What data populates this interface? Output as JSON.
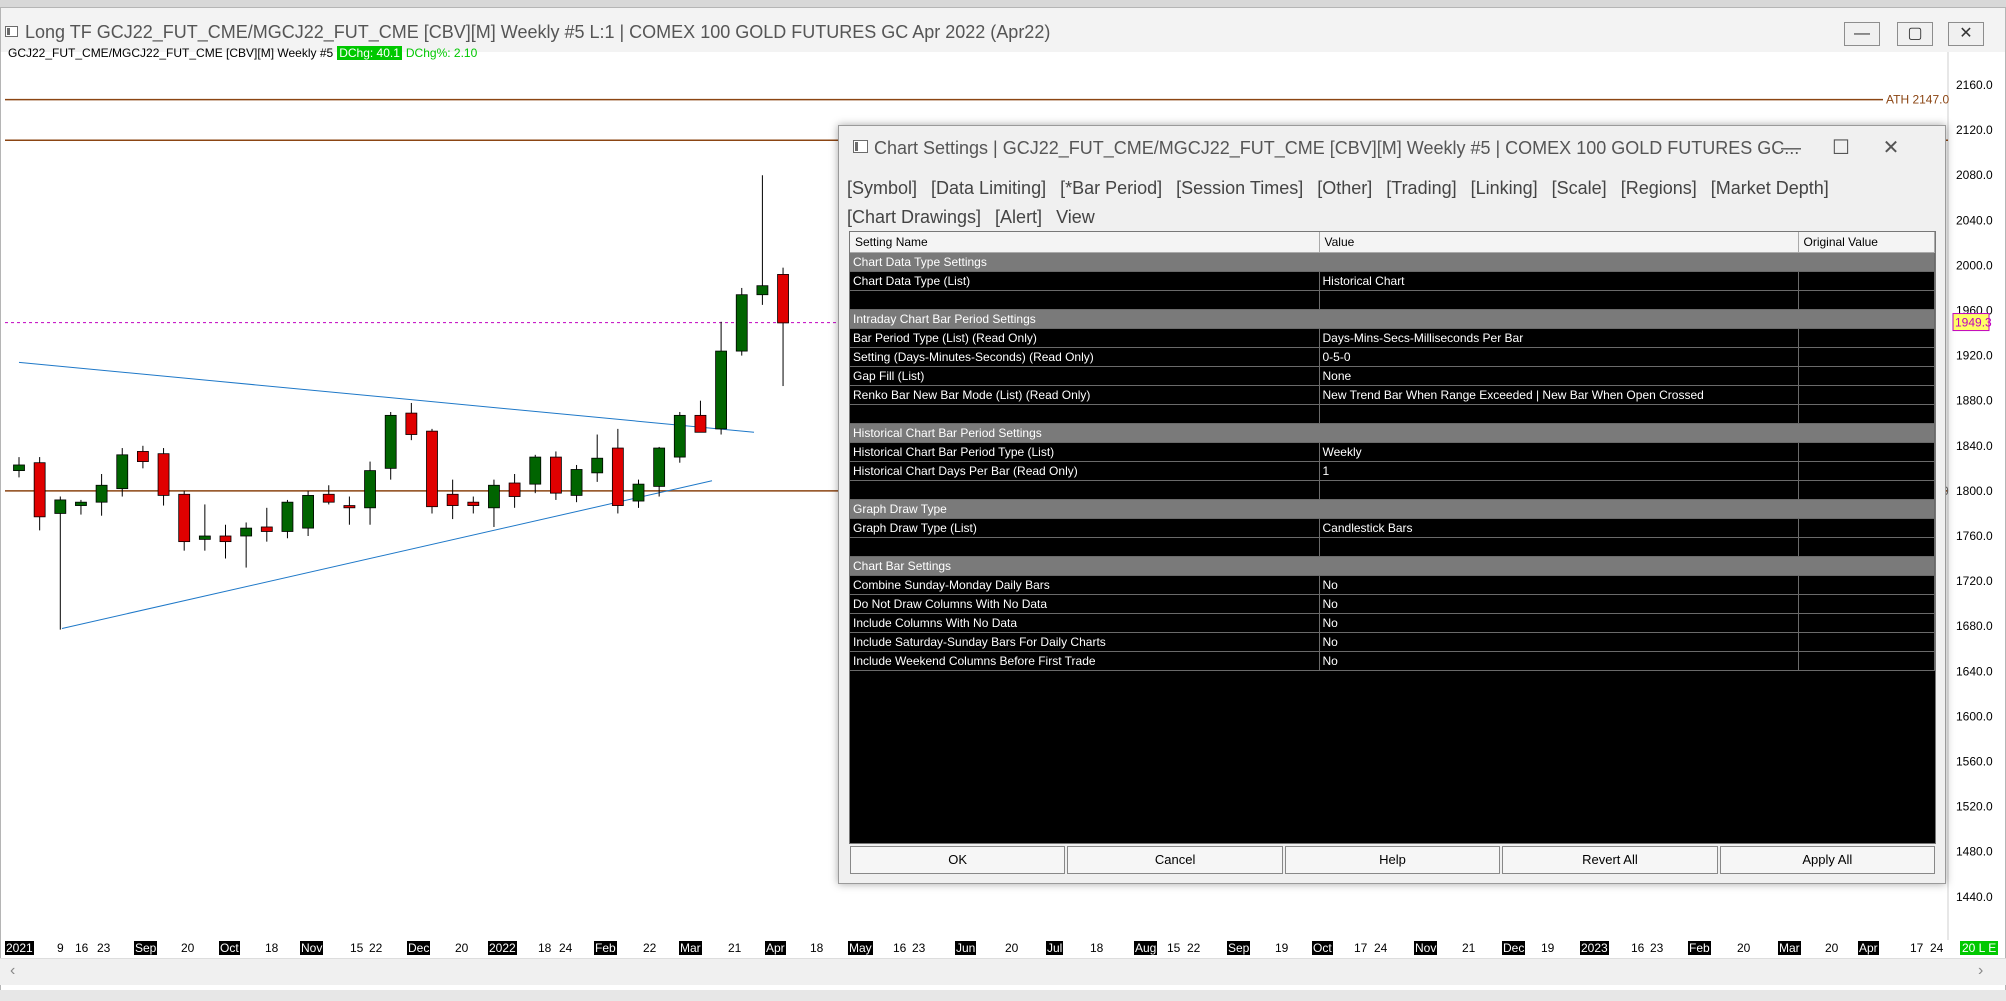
{
  "main_window": {
    "title": "Long TF GCJ22_FUT_CME/MGCJ22_FUT_CME [CBV][M]  Weekly  #5 L:1 | COMEX 100 GOLD FUTURES GC Apr 2022 (Apr22)",
    "minimize": "—",
    "maximize": "▢",
    "close": "✕"
  },
  "chart_info": {
    "symbol_text": "GCJ22_FUT_CME/MGCJ22_FUT_CME [CBV][M]  Weekly  #5",
    "dchg": "DChg: 40.1",
    "dchg_pct": "DChg%: 2.10"
  },
  "price_markers": {
    "ath_label": "ATH  2147.0",
    "last_price": "1949.3",
    "partial_label": "0"
  },
  "colors": {
    "up": "#006400",
    "down": "#e00000",
    "ath_line": "#8b4513",
    "trendline": "#1e78c8",
    "last_price_line": "#c000c0",
    "accent_green": "#00c800"
  },
  "chart_data": {
    "type": "candlestick",
    "yticks": [
      "2160.0",
      "2120.0",
      "2080.0",
      "2040.0",
      "2000.0",
      "1960.0",
      "1920.0",
      "1880.0",
      "1840.0",
      "1800.0",
      "1760.0",
      "1720.0",
      "1680.0",
      "1640.0",
      "1600.0",
      "1560.0",
      "1520.0",
      "1480.0",
      "1440.0"
    ],
    "ylim": [
      1440,
      2160
    ],
    "horizontal_lines": [
      2147.0,
      2111.0,
      1800.0
    ],
    "last_price": 1949.3,
    "candles": [
      {
        "o": 1818,
        "h": 1830,
        "l": 1812,
        "c": 1823
      },
      {
        "o": 1825,
        "h": 1830,
        "l": 1765,
        "c": 1777
      },
      {
        "o": 1780,
        "h": 1795,
        "l": 1677,
        "c": 1792
      },
      {
        "o": 1787,
        "h": 1792,
        "l": 1779,
        "c": 1790
      },
      {
        "o": 1790,
        "h": 1815,
        "l": 1778,
        "c": 1805
      },
      {
        "o": 1802,
        "h": 1838,
        "l": 1795,
        "c": 1832
      },
      {
        "o": 1835,
        "h": 1840,
        "l": 1820,
        "c": 1826
      },
      {
        "o": 1833,
        "h": 1838,
        "l": 1787,
        "c": 1796
      },
      {
        "o": 1797,
        "h": 1800,
        "l": 1747,
        "c": 1755
      },
      {
        "o": 1757,
        "h": 1788,
        "l": 1747,
        "c": 1760
      },
      {
        "o": 1760,
        "h": 1770,
        "l": 1740,
        "c": 1755
      },
      {
        "o": 1760,
        "h": 1772,
        "l": 1732,
        "c": 1767
      },
      {
        "o": 1768,
        "h": 1785,
        "l": 1755,
        "c": 1764
      },
      {
        "o": 1764,
        "h": 1792,
        "l": 1758,
        "c": 1790
      },
      {
        "o": 1767,
        "h": 1800,
        "l": 1760,
        "c": 1796
      },
      {
        "o": 1797,
        "h": 1805,
        "l": 1788,
        "c": 1790
      },
      {
        "o": 1787,
        "h": 1795,
        "l": 1770,
        "c": 1785
      },
      {
        "o": 1785,
        "h": 1826,
        "l": 1770,
        "c": 1818
      },
      {
        "o": 1820,
        "h": 1870,
        "l": 1810,
        "c": 1867
      },
      {
        "o": 1869,
        "h": 1878,
        "l": 1845,
        "c": 1850
      },
      {
        "o": 1853,
        "h": 1855,
        "l": 1780,
        "c": 1786
      },
      {
        "o": 1797,
        "h": 1810,
        "l": 1775,
        "c": 1787
      },
      {
        "o": 1790,
        "h": 1795,
        "l": 1780,
        "c": 1787
      },
      {
        "o": 1785,
        "h": 1810,
        "l": 1768,
        "c": 1805
      },
      {
        "o": 1807,
        "h": 1815,
        "l": 1785,
        "c": 1795
      },
      {
        "o": 1806,
        "h": 1832,
        "l": 1798,
        "c": 1830
      },
      {
        "o": 1830,
        "h": 1835,
        "l": 1792,
        "c": 1798
      },
      {
        "o": 1796,
        "h": 1823,
        "l": 1790,
        "c": 1819
      },
      {
        "o": 1816,
        "h": 1850,
        "l": 1808,
        "c": 1829
      },
      {
        "o": 1838,
        "h": 1855,
        "l": 1780,
        "c": 1787
      },
      {
        "o": 1791,
        "h": 1810,
        "l": 1785,
        "c": 1806
      },
      {
        "o": 1804,
        "h": 1839,
        "l": 1795,
        "c": 1838
      },
      {
        "o": 1830,
        "h": 1870,
        "l": 1825,
        "c": 1867
      },
      {
        "o": 1867,
        "h": 1880,
        "l": 1853,
        "c": 1852
      },
      {
        "o": 1855,
        "h": 1950,
        "l": 1850,
        "c": 1924
      },
      {
        "o": 1924,
        "h": 1980,
        "l": 1920,
        "c": 1974
      },
      {
        "o": 1974,
        "h": 2080,
        "l": 1965,
        "c": 1982
      },
      {
        "o": 1992,
        "h": 1998,
        "l": 1893,
        "c": 1949
      }
    ],
    "xticks": [
      {
        "t": "2021",
        "dark": true
      },
      {
        "t": "9",
        "dark": false
      },
      {
        "t": "16",
        "dark": false
      },
      {
        "t": "23",
        "dark": false
      },
      {
        "t": "Sep",
        "dark": true
      },
      {
        "t": "20",
        "dark": false
      },
      {
        "t": "Oct",
        "dark": true
      },
      {
        "t": "18",
        "dark": false
      },
      {
        "t": "Nov",
        "dark": true
      },
      {
        "t": "15",
        "dark": false
      },
      {
        "t": "22",
        "dark": false
      },
      {
        "t": "Dec",
        "dark": true
      },
      {
        "t": "20",
        "dark": false
      },
      {
        "t": "2022",
        "dark": true
      },
      {
        "t": "18",
        "dark": false
      },
      {
        "t": "24",
        "dark": false
      },
      {
        "t": "Feb",
        "dark": true
      },
      {
        "t": "22",
        "dark": false
      },
      {
        "t": "Mar",
        "dark": true
      },
      {
        "t": "21",
        "dark": false
      },
      {
        "t": "Apr",
        "dark": true
      },
      {
        "t": "18",
        "dark": false
      },
      {
        "t": "May",
        "dark": true
      },
      {
        "t": "16",
        "dark": false
      },
      {
        "t": "23",
        "dark": false
      },
      {
        "t": "Jun",
        "dark": true
      },
      {
        "t": "20",
        "dark": false
      },
      {
        "t": "Jul",
        "dark": true
      },
      {
        "t": "18",
        "dark": false
      },
      {
        "t": "Aug",
        "dark": true
      },
      {
        "t": "15",
        "dark": false
      },
      {
        "t": "22",
        "dark": false
      },
      {
        "t": "Sep",
        "dark": true
      },
      {
        "t": "19",
        "dark": false
      },
      {
        "t": "Oct",
        "dark": true
      },
      {
        "t": "17",
        "dark": false
      },
      {
        "t": "24",
        "dark": false
      },
      {
        "t": "Nov",
        "dark": true
      },
      {
        "t": "21",
        "dark": false
      },
      {
        "t": "Dec",
        "dark": true
      },
      {
        "t": "19",
        "dark": false
      },
      {
        "t": "2023",
        "dark": true
      },
      {
        "t": "16",
        "dark": false
      },
      {
        "t": "23",
        "dark": false
      },
      {
        "t": "Feb",
        "dark": true
      },
      {
        "t": "20",
        "dark": false
      },
      {
        "t": "Mar",
        "dark": true
      },
      {
        "t": "20",
        "dark": false
      },
      {
        "t": "Apr",
        "dark": true
      },
      {
        "t": "17",
        "dark": false
      },
      {
        "t": "24",
        "dark": false
      },
      {
        "t": "20 L E",
        "dark": false,
        "last": true
      }
    ]
  },
  "dialog": {
    "title": "Chart Settings | GCJ22_FUT_CME/MGCJ22_FUT_CME [CBV][M]  Weekly  #5 | COMEX 100 GOLD FUTURES GC...",
    "minimize": "—",
    "maximize": "☐",
    "close": "✕",
    "tabs": [
      "[Symbol]",
      "[Data Limiting]",
      "[*Bar Period]",
      "[Session Times]",
      "[Other]",
      "[Trading]",
      "[Linking]",
      "[Scale]",
      "[Regions]",
      "[Market Depth]",
      "[Chart Drawings]",
      "[Alert]",
      "View"
    ],
    "columns": {
      "name": "Setting Name",
      "value": "Value",
      "original": "Original Value"
    },
    "rows": [
      {
        "kind": "section",
        "name": "Chart Data Type Settings"
      },
      {
        "kind": "row",
        "name": "Chart Data Type (List)",
        "value": "Historical Chart"
      },
      {
        "kind": "blank"
      },
      {
        "kind": "section",
        "name": "Intraday Chart Bar Period Settings"
      },
      {
        "kind": "row",
        "name": "Bar Period Type (List) (Read Only)",
        "value": "Days-Mins-Secs-Milliseconds Per Bar"
      },
      {
        "kind": "row",
        "name": "Setting (Days-Minutes-Seconds) (Read Only)",
        "value": "0-5-0"
      },
      {
        "kind": "row",
        "name": "Gap Fill (List)",
        "value": "None"
      },
      {
        "kind": "row",
        "name": "Renko Bar New Bar Mode (List) (Read Only)",
        "value": "New Trend Bar When Range Exceeded | New Bar When Open Crossed"
      },
      {
        "kind": "blank"
      },
      {
        "kind": "section",
        "name": "Historical Chart Bar Period Settings"
      },
      {
        "kind": "row",
        "name": "Historical Chart Bar Period Type (List)",
        "value": "Weekly"
      },
      {
        "kind": "row",
        "name": "Historical Chart Days Per Bar (Read Only)",
        "value": "1"
      },
      {
        "kind": "blank"
      },
      {
        "kind": "section",
        "name": "Graph Draw Type"
      },
      {
        "kind": "row",
        "name": "Graph Draw Type (List)",
        "value": "Candlestick Bars"
      },
      {
        "kind": "blank"
      },
      {
        "kind": "section",
        "name": "Chart Bar Settings"
      },
      {
        "kind": "row",
        "name": "Combine Sunday-Monday Daily Bars",
        "value": "No"
      },
      {
        "kind": "row",
        "name": "Do Not Draw Columns With No Data",
        "value": "No"
      },
      {
        "kind": "row",
        "name": "Include Columns With No Data",
        "value": "No"
      },
      {
        "kind": "row",
        "name": "Include Saturday-Sunday Bars For Daily Charts",
        "value": "No"
      },
      {
        "kind": "row",
        "name": "Include Weekend Columns Before First Trade",
        "value": "No"
      }
    ],
    "buttons": [
      "OK",
      "Cancel",
      "Help",
      "Revert All",
      "Apply All"
    ]
  }
}
